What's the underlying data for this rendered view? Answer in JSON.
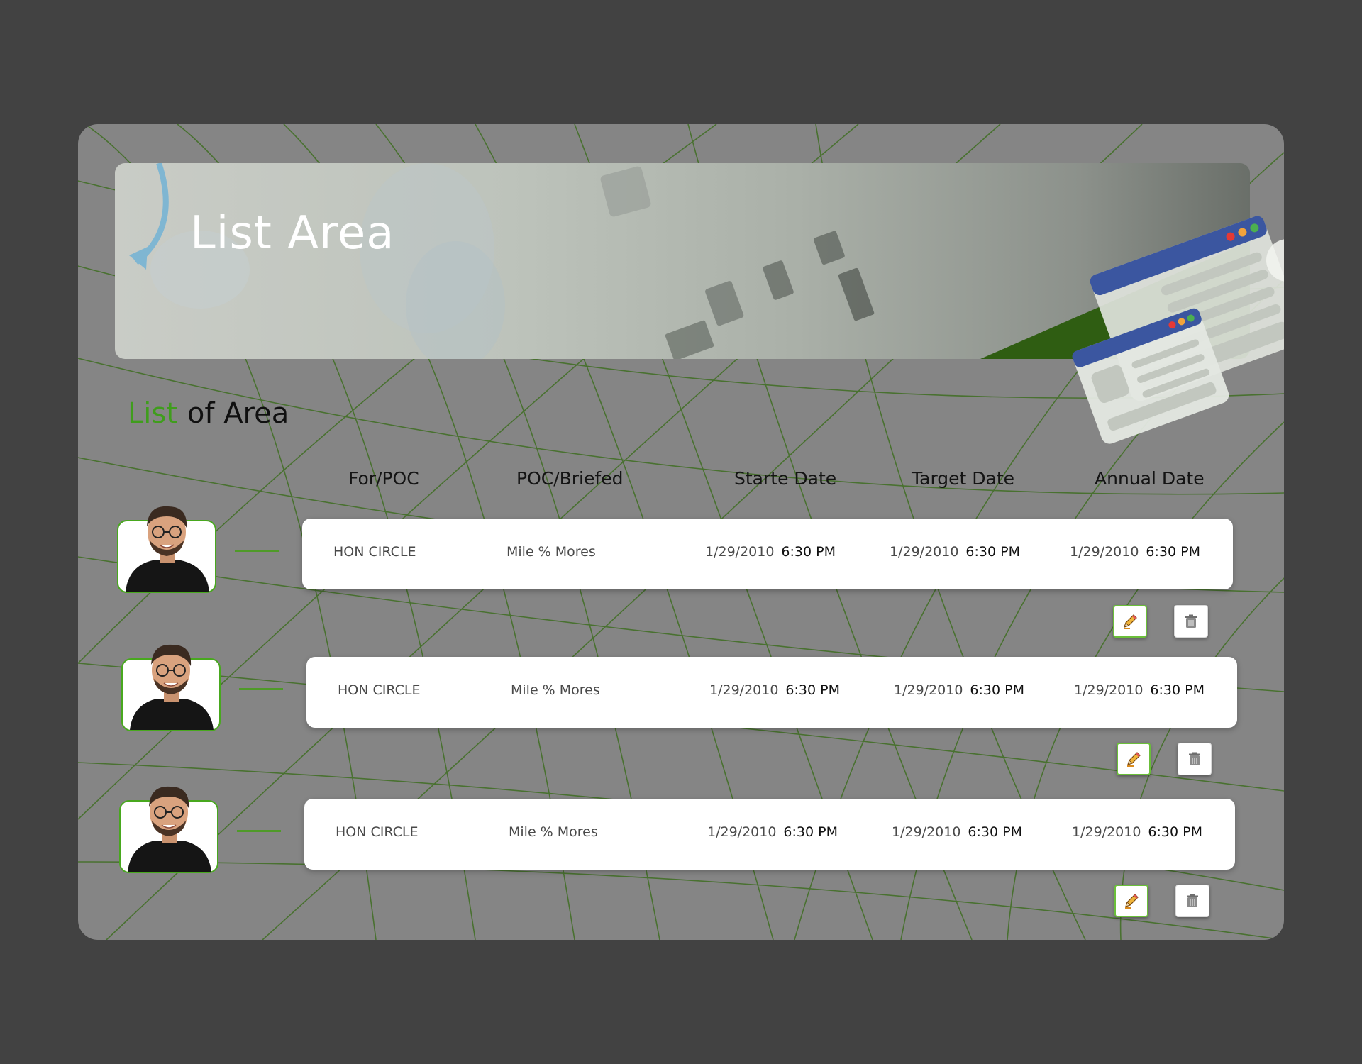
{
  "hero": {
    "title": "List Area"
  },
  "section": {
    "accent": "List",
    "rest": "of Area"
  },
  "columns": {
    "for_poc": "For/POC",
    "poc_briefed": "POC/Briefed",
    "start": "Starte Date",
    "target": "Target Date",
    "annual": "Annual Date"
  },
  "rows": [
    {
      "name": "HON CIRCLE",
      "poc": "Mile % Mores",
      "start_date": "1/29/2010",
      "start_time": "6:30 PM",
      "target_date": "1/29/2010",
      "target_time": "6:30 PM",
      "annual_date": "1/29/2010",
      "annual_time": "6:30 PM"
    },
    {
      "name": "HON CIRCLE",
      "poc": "Mile % Mores",
      "start_date": "1/29/2010",
      "start_time": "6:30 PM",
      "target_date": "1/29/2010",
      "target_time": "6:30 PM",
      "annual_date": "1/29/2010",
      "annual_time": "6:30 PM"
    },
    {
      "name": "HON CIRCLE",
      "poc": "Mile % Mores",
      "start_date": "1/29/2010",
      "start_time": "6:30 PM",
      "target_date": "1/29/2010",
      "target_time": "6:30 PM",
      "annual_date": "1/29/2010",
      "annual_time": "6:30 PM"
    }
  ],
  "icons": {
    "edit": "pencil-icon",
    "delete": "trash-icon"
  },
  "colors": {
    "accent": "#3f9d1c",
    "page_bg": "#424242",
    "card_bg": "#858585",
    "row_bg": "#ffffff"
  }
}
